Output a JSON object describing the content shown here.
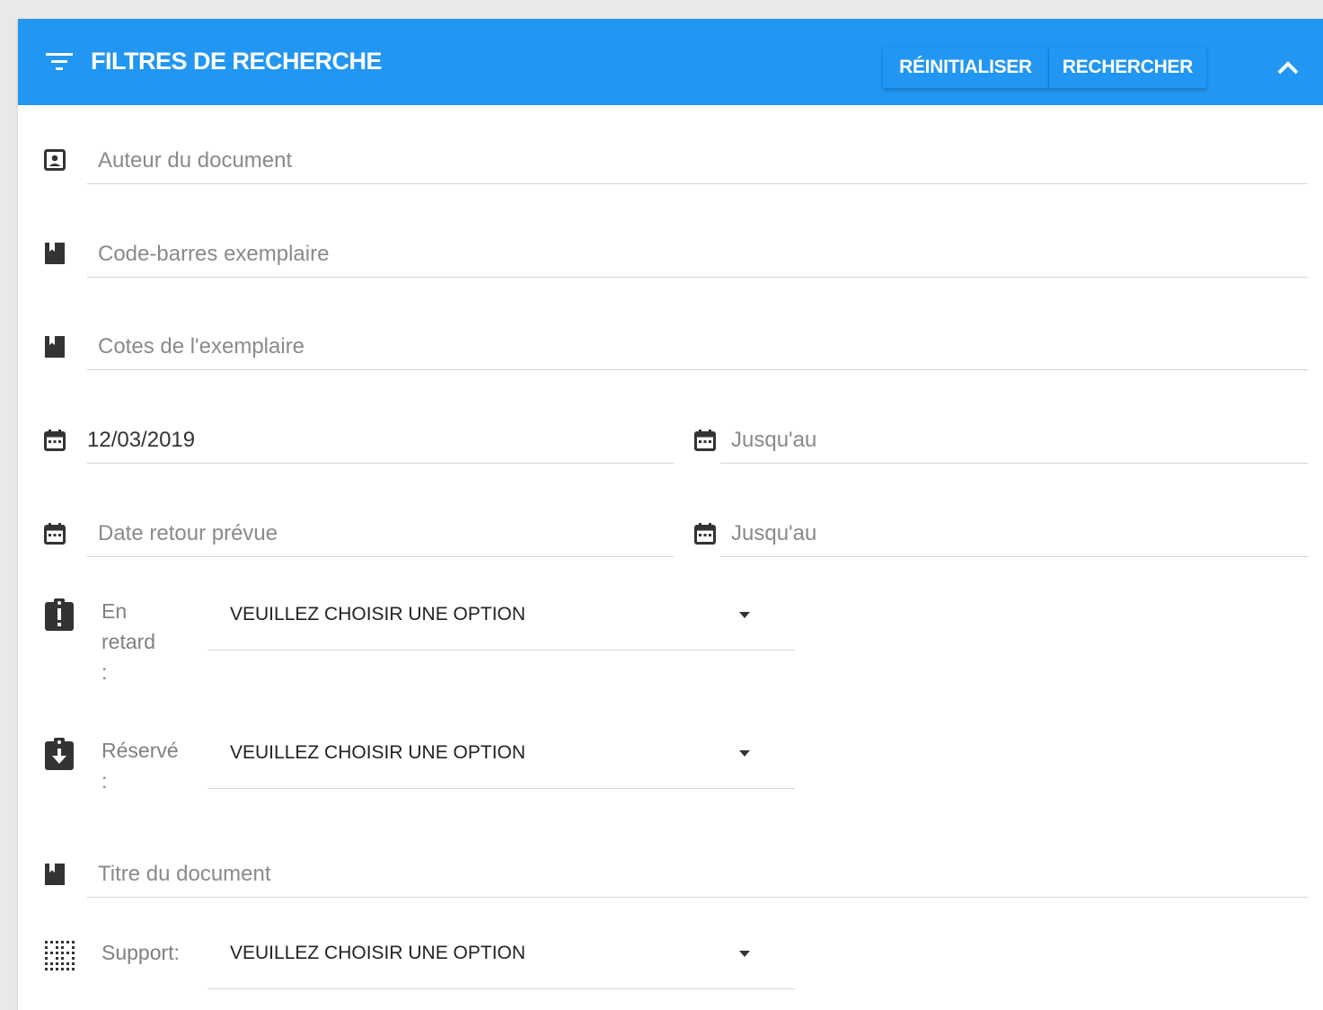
{
  "header": {
    "title": "FILTRES DE RECHERCHE",
    "reset_label": "RÉINITIALISER",
    "search_label": "RECHERCHER",
    "icon": "filter-icon",
    "collapse_icon": "chevron-up-icon"
  },
  "colors": {
    "accent": "#2196f3",
    "header_text": "#ffffff"
  },
  "fields": {
    "author": {
      "placeholder": "Auteur du document",
      "value": "",
      "icon": "contact-icon"
    },
    "barcode": {
      "placeholder": "Code-barres exemplaire",
      "value": "",
      "icon": "book-icon"
    },
    "shelfmark": {
      "placeholder": "Cotes de l'exemplaire",
      "value": "",
      "icon": "book-icon"
    },
    "date_from": {
      "placeholder": "",
      "value": "12/03/2019",
      "icon": "calendar-icon"
    },
    "date_to": {
      "placeholder": "Jusqu'au",
      "value": "",
      "icon": "calendar-icon"
    },
    "return_from": {
      "placeholder": "Date retour prévue",
      "value": "",
      "icon": "calendar-icon"
    },
    "return_to": {
      "placeholder": "Jusqu'au",
      "value": "",
      "icon": "calendar-icon"
    },
    "title": {
      "placeholder": "Titre du document",
      "value": "",
      "icon": "book-icon"
    }
  },
  "selects": {
    "late": {
      "label_lines": [
        "En",
        "retard",
        ":"
      ],
      "selected": "VEUILLEZ CHOISIR UNE OPTION",
      "icon": "clipboard-alert-icon"
    },
    "reserved": {
      "label_lines": [
        "Réservé",
        ":"
      ],
      "selected": "VEUILLEZ CHOISIR UNE OPTION",
      "icon": "clipboard-arrow-down-icon"
    },
    "support": {
      "label": "Support:",
      "selected": "VEUILLEZ CHOISIR UNE OPTION",
      "icon": "grid-dots-icon"
    }
  }
}
